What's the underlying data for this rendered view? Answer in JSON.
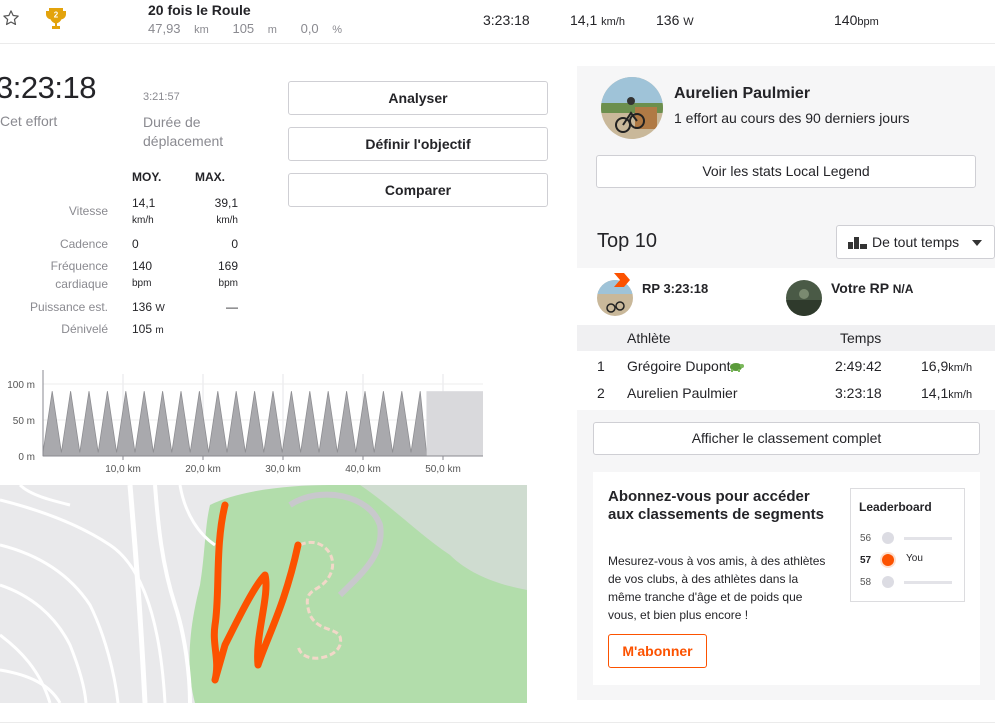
{
  "segment": {
    "title": "20 fois le Roule",
    "distance": "47,93",
    "distance_unit": "km",
    "elevation": "105",
    "elevation_unit": "m",
    "grade": "0,0",
    "grade_unit": "%",
    "time": "3:23:18",
    "speed": "14,1",
    "speed_unit": "km/h",
    "power": "136",
    "power_unit": "W",
    "hr": "140",
    "hr_unit": "bpm",
    "trophy_rank": "2"
  },
  "effort": {
    "elapsed": "3:23:18",
    "elapsed_label": "Cet effort",
    "moving": "3:21:57",
    "moving_label": "Durée de déplacement",
    "buttons": {
      "analyze": "Analyser",
      "goal": "Définir l'objectif",
      "compare": "Comparer"
    },
    "stats_header": {
      "avg": "MOY.",
      "max": "MAX."
    },
    "stats": [
      {
        "label": "Vitesse",
        "avg": "14,1",
        "avg_unit": "km/h",
        "max": "39,1",
        "max_unit": "km/h"
      },
      {
        "label": "Cadence",
        "avg": "0",
        "avg_unit": "",
        "max": "0",
        "max_unit": ""
      },
      {
        "label": "Fréquence cardiaque",
        "avg": "140",
        "avg_unit": "bpm",
        "max": "169",
        "max_unit": "bpm"
      },
      {
        "label": "Puissance est.",
        "avg": "136",
        "avg_unit": "W",
        "max": "—",
        "max_unit": ""
      },
      {
        "label": "Dénivelé",
        "avg": "105",
        "avg_unit": "m",
        "max": "",
        "max_unit": ""
      }
    ]
  },
  "chart_data": {
    "type": "area",
    "title": "",
    "y_ticks": [
      "100 m",
      "50 m",
      "0 m"
    ],
    "x_ticks": [
      "10,0 km",
      "20,0 km",
      "30,0 km",
      "40,0 km",
      "50,0 km"
    ],
    "ylim": [
      0,
      100
    ],
    "xlim": [
      0,
      55
    ],
    "series": [
      {
        "x": [
          0,
          1.15,
          2.3,
          3.45,
          4.6,
          5.75,
          6.9,
          8.05,
          9.2,
          10.35,
          11.5,
          12.65,
          13.8,
          14.95,
          16.1,
          17.25,
          18.4,
          19.55,
          20.7,
          21.85,
          23,
          24.15,
          25.3,
          26.45,
          27.6,
          28.75,
          29.9,
          31.05,
          32.2,
          33.35,
          34.5,
          35.65,
          36.8,
          37.95,
          39.1,
          40.25,
          41.4,
          42.55,
          43.7,
          44.85,
          46,
          47.15,
          47.93
        ],
        "y": [
          5,
          90,
          5,
          90,
          5,
          90,
          5,
          90,
          5,
          90,
          5,
          90,
          5,
          90,
          5,
          90,
          5,
          90,
          5,
          90,
          5,
          90,
          5,
          90,
          5,
          90,
          5,
          90,
          5,
          90,
          5,
          90,
          5,
          90,
          5,
          90,
          5,
          90,
          5,
          90,
          5,
          90,
          5
        ]
      }
    ],
    "grid": true
  },
  "legend": {
    "name": "Aurelien Paulmier",
    "subtitle": "1 effort au cours des 90 derniers jours",
    "button": "Voir les stats Local Legend"
  },
  "leaderboard": {
    "title": "Top 10",
    "filter": "De tout temps",
    "pr_label": "RP",
    "pr_value": "3:23:18",
    "your_pr_label": "Votre RP",
    "your_pr_value": "N/A",
    "col_athlete": "Athlète",
    "col_time": "Temps",
    "rows": [
      {
        "rank": "1",
        "name": "Grégoire Dupont",
        "time": "2:49:42",
        "speed": "16,9",
        "unit": "km/h"
      },
      {
        "rank": "2",
        "name": "Aurelien Paulmier",
        "time": "3:23:18",
        "speed": "14,1",
        "unit": "km/h"
      }
    ],
    "full_button": "Afficher le classement complet"
  },
  "subscribe": {
    "title": "Abonnez-vous pour accéder aux classements de segments",
    "description": "Mesurez-vous à vos amis, à des athlètes de vos clubs, à des athlètes dans la même tranche d'âge et de poids que vous, et bien plus encore !",
    "button": "M'abonner",
    "mini": {
      "title": "Leaderboard",
      "rows": [
        {
          "n": "56",
          "label": ""
        },
        {
          "n": "57",
          "label": "You"
        },
        {
          "n": "58",
          "label": ""
        }
      ]
    }
  },
  "colors": {
    "brand": "#fc5200",
    "gold": "#e3a30c"
  }
}
